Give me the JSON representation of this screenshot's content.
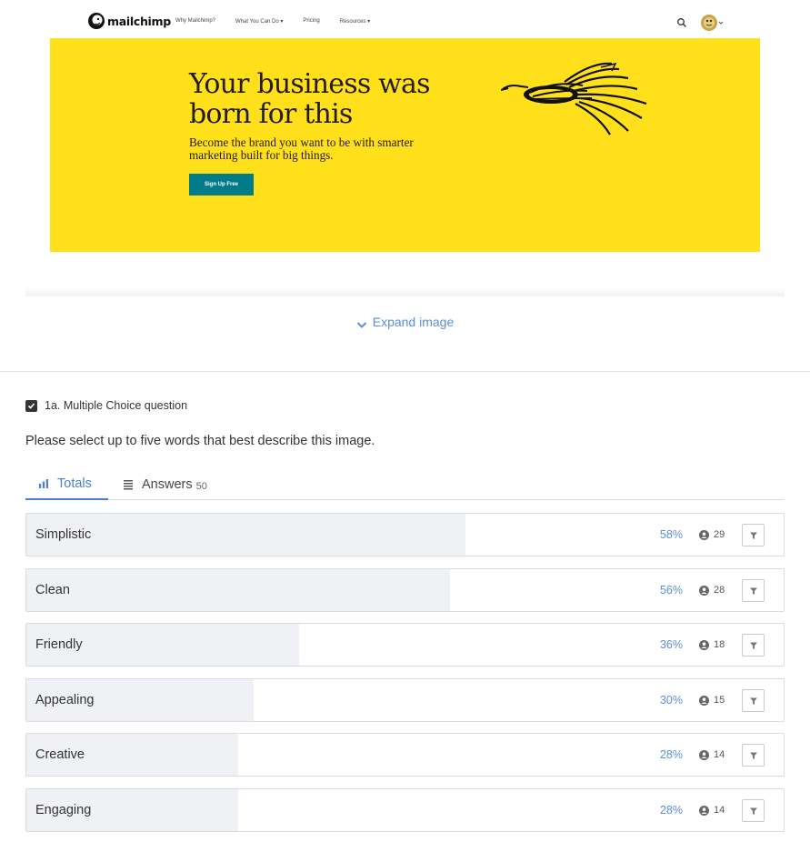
{
  "preview": {
    "site_nav": {
      "logo_text": "mailchimp",
      "links": [
        "Why Mailchimp?",
        "What You Can Do ▾",
        "Pricing",
        "Resources ▾"
      ],
      "icons": [
        "search-icon",
        "avatar-icon"
      ]
    },
    "hero": {
      "title": "Your business was born for this",
      "subtitle": "Become the brand you want to be with smarter marketing built for big things.",
      "cta_label": "Sign Up Free",
      "background_color": "#ffe01b",
      "button_color": "#007c89",
      "illustration": "bird-illustration"
    },
    "expand_label": "Expand image"
  },
  "question": {
    "title": "1a. Multiple Choice question",
    "prompt": "Please select up to five words that best describe this image."
  },
  "tabs": {
    "totals_label": "Totals",
    "answers_label": "Answers",
    "answers_count": "50"
  },
  "results": [
    {
      "label": "Simplistic",
      "percent": "58%",
      "count": "29",
      "fill_fraction": 0.58
    },
    {
      "label": "Clean",
      "percent": "56%",
      "count": "28",
      "fill_fraction": 0.56
    },
    {
      "label": "Friendly",
      "percent": "36%",
      "count": "18",
      "fill_fraction": 0.36
    },
    {
      "label": "Appealing",
      "percent": "30%",
      "count": "15",
      "fill_fraction": 0.3
    },
    {
      "label": "Creative",
      "percent": "28%",
      "count": "14",
      "fill_fraction": 0.28
    },
    {
      "label": "Engaging",
      "percent": "28%",
      "count": "14",
      "fill_fraction": 0.28
    }
  ],
  "colors": {
    "accent": "#4a7fcf",
    "percent_text": "#5b8fd6",
    "bar_fill": "#f0f1f5"
  }
}
